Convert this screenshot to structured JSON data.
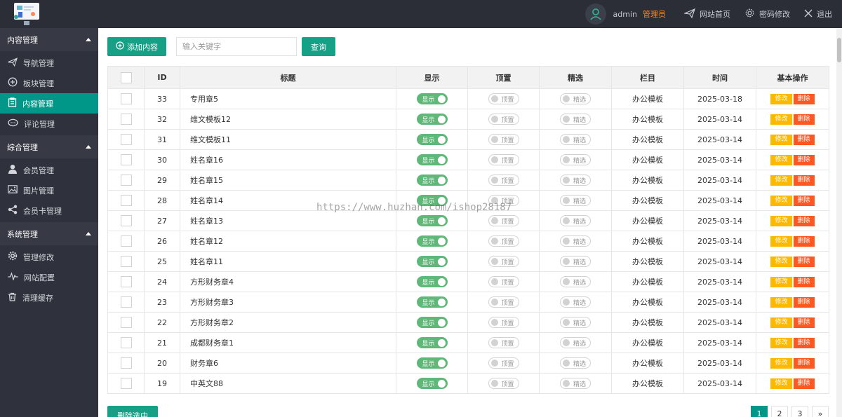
{
  "header": {
    "admin_name": "admin",
    "admin_role": "管理员",
    "links": [
      "网站首页",
      "密码修改",
      "退出"
    ]
  },
  "sidebar": {
    "groups": [
      {
        "title": "内容管理",
        "items": [
          "导航管理",
          "板块管理",
          "内容管理",
          "评论管理"
        ]
      },
      {
        "title": "综合管理",
        "items": [
          "会员管理",
          "图片管理",
          "会员卡管理"
        ]
      },
      {
        "title": "系统管理",
        "items": [
          "管理修改",
          "网站配置",
          "清理缓存"
        ]
      }
    ],
    "active_item": "内容管理"
  },
  "toolbar": {
    "add_label": "添加内容",
    "search_placeholder": "输入关键字",
    "query_label": "查询"
  },
  "table": {
    "headers": [
      "ID",
      "标题",
      "显示",
      "顶置",
      "精选",
      "栏目",
      "时间",
      "基本操作"
    ],
    "toggle_labels": {
      "show": "显示",
      "top": "顶置",
      "featured": "精选"
    },
    "action_labels": {
      "edit": "修改",
      "delete": "删除"
    },
    "rows": [
      {
        "id": "33",
        "title": "专用章5",
        "category": "办公模板",
        "date": "2025-03-18"
      },
      {
        "id": "32",
        "title": "维文模板12",
        "category": "办公模板",
        "date": "2025-03-14"
      },
      {
        "id": "31",
        "title": "维文模板11",
        "category": "办公模板",
        "date": "2025-03-14"
      },
      {
        "id": "30",
        "title": "姓名章16",
        "category": "办公模板",
        "date": "2025-03-14"
      },
      {
        "id": "29",
        "title": "姓名章15",
        "category": "办公模板",
        "date": "2025-03-14"
      },
      {
        "id": "28",
        "title": "姓名章14",
        "category": "办公模板",
        "date": "2025-03-14"
      },
      {
        "id": "27",
        "title": "姓名章13",
        "category": "办公模板",
        "date": "2025-03-14"
      },
      {
        "id": "26",
        "title": "姓名章12",
        "category": "办公模板",
        "date": "2025-03-14"
      },
      {
        "id": "25",
        "title": "姓名章11",
        "category": "办公模板",
        "date": "2025-03-14"
      },
      {
        "id": "24",
        "title": "方形财务章4",
        "category": "办公模板",
        "date": "2025-03-14"
      },
      {
        "id": "23",
        "title": "方形财务章3",
        "category": "办公模板",
        "date": "2025-03-14"
      },
      {
        "id": "22",
        "title": "方形财务章2",
        "category": "办公模板",
        "date": "2025-03-14"
      },
      {
        "id": "21",
        "title": "成都财务章1",
        "category": "办公模板",
        "date": "2025-03-14"
      },
      {
        "id": "20",
        "title": "财务章6",
        "category": "办公模板",
        "date": "2025-03-14"
      },
      {
        "id": "19",
        "title": "中英文88",
        "category": "办公模板",
        "date": "2025-03-14"
      }
    ]
  },
  "footer": {
    "delete_selected_label": "删除选中",
    "pages": [
      "1",
      "2",
      "3",
      "»"
    ],
    "current_page": "1"
  },
  "watermark": "https://www.huzhan.com/ishop28187",
  "colors": {
    "header_bg": "#2b2e37",
    "sidebar_bg": "#2f323c",
    "accent": "#009688",
    "switch_on": "#5fb878",
    "edit": "#ffb800",
    "delete": "#ff5722",
    "role": "#ff8a1e"
  },
  "icons": {
    "sidebar": [
      "paper-plane-icon",
      "plus-circle-icon",
      "clipboard-icon",
      "comment-icon",
      "user-icon",
      "image-icon",
      "share-icon",
      "gear-icon",
      "pulse-icon",
      "trash-icon"
    ],
    "header": [
      "send-icon",
      "gear-icon",
      "close-icon"
    ]
  }
}
